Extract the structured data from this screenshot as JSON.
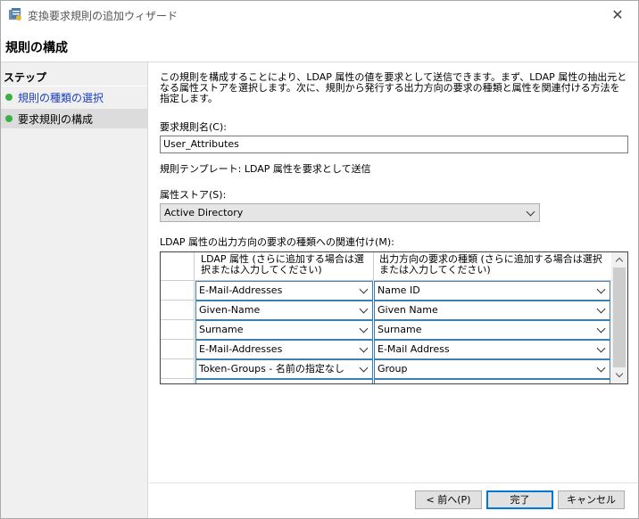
{
  "window": {
    "title": "変換要求規則の追加ウィザード",
    "close_glyph": "✕"
  },
  "page": {
    "title": "規則の構成"
  },
  "sidebar": {
    "heading": "ステップ",
    "steps": [
      {
        "label": "規則の種類の選択",
        "status_color": "#3cb043"
      },
      {
        "label": "要求規則の構成",
        "status_color": "#3cb043"
      }
    ]
  },
  "main": {
    "description": "この規則を構成することにより、LDAP 属性の値を要求として送信できます。まず、LDAP 属性の抽出元となる属性ストアを選択します。次に、規則から発行する出力方向の要求の種類と属性を関連付ける方法を指定します。",
    "rule_name_label": "要求規則名(C):",
    "rule_name_value": "User_Attributes",
    "template_text": "規則テンプレート: LDAP 属性を要求として送信",
    "attribute_store_label": "属性ストア(S):",
    "attribute_store_value": "Active Directory",
    "mapping_label": "LDAP 属性の出力方向の要求の種類への関連付け(M):",
    "grid": {
      "col1_header": "LDAP 属性 (さらに追加する場合は選択または入力してください)",
      "col2_header": "出力方向の要求の種類 (さらに追加する場合は選択または入力してください)",
      "rows": [
        {
          "ldap": "E-Mail-Addresses",
          "claim": "Name ID"
        },
        {
          "ldap": "Given-Name",
          "claim": "Given Name"
        },
        {
          "ldap": "Surname",
          "claim": "Surname"
        },
        {
          "ldap": "E-Mail-Addresses",
          "claim": "E-Mail Address"
        },
        {
          "ldap": "Token-Groups - 名前の指定なし",
          "claim": "Group"
        }
      ]
    }
  },
  "buttons": {
    "back": "< 前へ(P)",
    "finish": "完了",
    "cancel": "キャンセル"
  }
}
